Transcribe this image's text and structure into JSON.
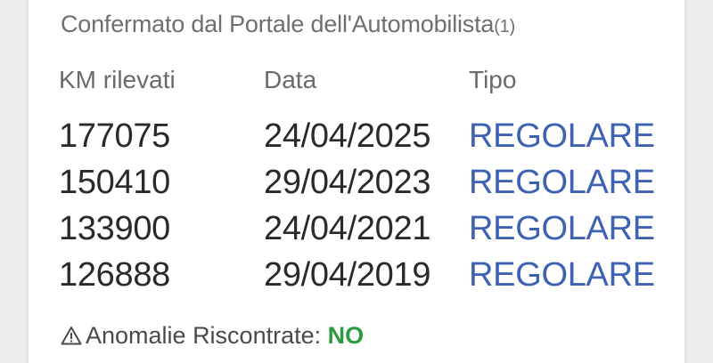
{
  "header": {
    "title": "Confermato dal Portale dell'Automobilista",
    "count": "(1)"
  },
  "table": {
    "columns": [
      "KM rilevati",
      "Data",
      "Tipo"
    ],
    "rows": [
      {
        "km": "177075",
        "date": "24/04/2025",
        "type": "REGOLARE"
      },
      {
        "km": "150410",
        "date": "29/04/2023",
        "type": "REGOLARE"
      },
      {
        "km": "133900",
        "date": "24/04/2021",
        "type": "REGOLARE"
      },
      {
        "km": "126888",
        "date": "29/04/2019",
        "type": "REGOLARE"
      }
    ]
  },
  "footer": {
    "icon": "warning-triangle-icon",
    "label": "Anomalie Riscontrate: ",
    "value": "NO"
  },
  "colors": {
    "type_text": "#3d62b4",
    "ok_value": "#2c9a3e"
  }
}
